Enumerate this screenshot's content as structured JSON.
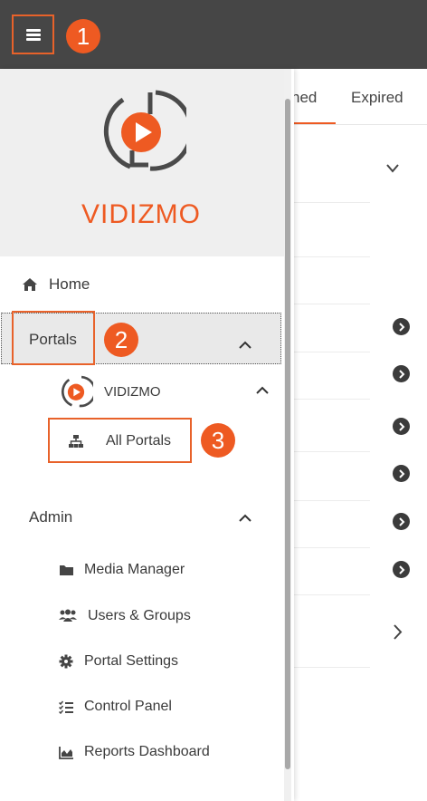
{
  "topbar": {
    "menu_icon": "hamburger-icon"
  },
  "badges": {
    "one": "1",
    "two": "2",
    "three": "3"
  },
  "background": {
    "tabs": [
      {
        "label": "hed"
      },
      {
        "label": "Expired"
      }
    ],
    "accent_color": "#ee5a22"
  },
  "sidebar": {
    "brand": "VIDIZMO",
    "items": {
      "home": "Home",
      "portals": "Portals",
      "vidizmo_portal": "VIDIZMO",
      "all_portals": "All Portals",
      "admin": "Admin",
      "media_manager": "Media Manager",
      "users_groups": "Users & Groups",
      "portal_settings": "Portal Settings",
      "control_panel": "Control Panel",
      "reports_dashboard": "Reports Dashboard"
    }
  },
  "colors": {
    "topbar": "#464646",
    "accent": "#ee5a22",
    "highlight_row": "#e9e9e9"
  }
}
